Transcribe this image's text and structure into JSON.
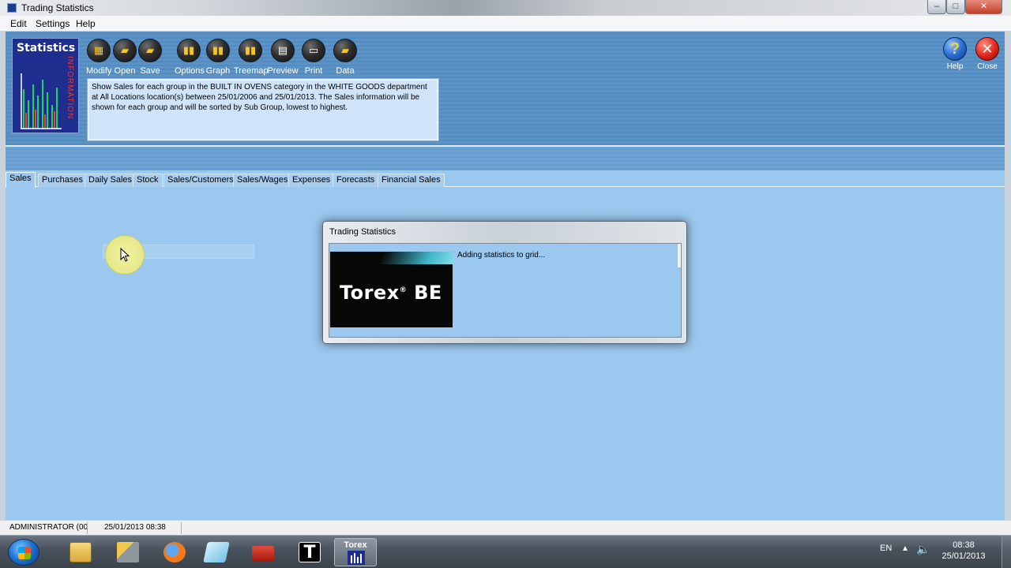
{
  "window": {
    "title": "Trading Statistics",
    "controls": {
      "minimize": "–",
      "maximize": "□",
      "close": "✕"
    }
  },
  "menu": [
    "Edit",
    "Settings",
    "Help"
  ],
  "logo": {
    "title": "Statistics",
    "vertical_text": "INFORMATION"
  },
  "toolbar": [
    {
      "label": "Modify",
      "icon": "grid-icon"
    },
    {
      "label": "Open",
      "icon": "folder-open-icon"
    },
    {
      "label": "Save",
      "icon": "save-icon"
    },
    {
      "label": "Options",
      "icon": "bar-chart-icon"
    },
    {
      "label": "Graph",
      "icon": "bar-chart-icon"
    },
    {
      "label": "Treemap",
      "icon": "bar-chart-icon"
    },
    {
      "label": "Preview",
      "icon": "document-icon"
    },
    {
      "label": "Print",
      "icon": "printer-icon"
    },
    {
      "label": "Data",
      "icon": "data-folder-icon"
    }
  ],
  "description": "Show Sales for each group in the BUILT IN OVENS category in the WHITE GOODS department at All Locations location(s) between 25/01/2006 and 25/01/2013.  The Sales information will be shown for each group and will be sorted by Sub Group, lowest to highest.",
  "right_buttons": {
    "help_label": "Help",
    "close_label": "Close",
    "help_glyph": "?",
    "close_glyph": "✕"
  },
  "tabs": [
    {
      "label": "Sales",
      "active": true
    },
    {
      "label": "Purchases",
      "active": false
    },
    {
      "label": "Daily Sales",
      "active": false
    },
    {
      "label": "Stock",
      "active": false
    },
    {
      "label": "Sales/Customers",
      "active": false
    },
    {
      "label": "Sales/Wages",
      "active": false
    },
    {
      "label": "Expenses",
      "active": false
    },
    {
      "label": "Forecasts",
      "active": false
    },
    {
      "label": "Financial Sales",
      "active": false
    }
  ],
  "dialog": {
    "title": "Trading Statistics",
    "message": "Adding statistics to grid...",
    "brand": "Torex",
    "brand_mark": "®",
    "brand_suffix": " BE"
  },
  "status": {
    "user": "ADMINISTRATOR (00(",
    "datetime": "25/01/2013 08:38"
  },
  "taskbar": {
    "torex_label": "Torex",
    "t_label": "T",
    "lang": "EN",
    "time": "08:38",
    "date": "25/01/2013"
  }
}
